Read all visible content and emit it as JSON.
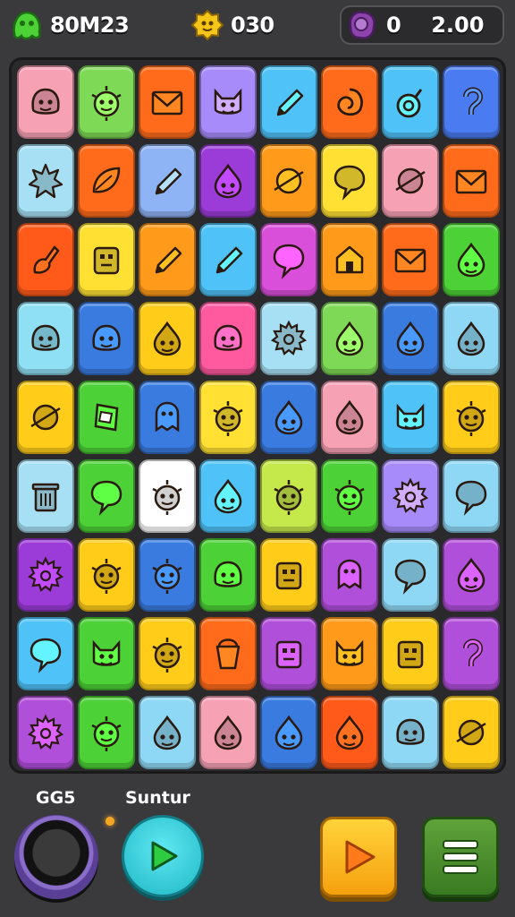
{
  "resources": {
    "gems": "80M23",
    "coins": "030",
    "energy": "0",
    "energy_max": "2.00"
  },
  "controls": {
    "left_label": "GG5",
    "right_label": "Suntur"
  },
  "colors": {
    "background": "#3a3a3d",
    "board": "#2a2a2c",
    "gem_icon": "#4cd137",
    "coin_icon": "#f5c518",
    "energy_icon": "#8e44ad"
  },
  "board": {
    "columns": 8,
    "rows": 9,
    "tiles": [
      [
        "#f7a1b5",
        "blob"
      ],
      [
        "#7ed957",
        "sun-face"
      ],
      [
        "#ff6b1a",
        "envelope"
      ],
      [
        "#a78bfa",
        "cat"
      ],
      [
        "#4fc3f7",
        "pencil"
      ],
      [
        "#ff6b1a",
        "swirl"
      ],
      [
        "#4fc3f7",
        "ring"
      ],
      [
        "#4a7bf0",
        "hook"
      ],
      [
        "#a7e0f5",
        "burst"
      ],
      [
        "#ff6b1a",
        "leaf"
      ],
      [
        "#8fb4f5",
        "pencil"
      ],
      [
        "#9b3bd8",
        "drop-face"
      ],
      [
        "#ff9a1a",
        "planet"
      ],
      [
        "#ffe033",
        "bubble"
      ],
      [
        "#f7a1b5",
        "planet"
      ],
      [
        "#ff6b1a",
        "envelope"
      ],
      [
        "#ff5a1a",
        "brush"
      ],
      [
        "#ffe033",
        "robot"
      ],
      [
        "#ff9a1a",
        "pencil"
      ],
      [
        "#4fc3f7",
        "pencil"
      ],
      [
        "#d94fd9",
        "bubble"
      ],
      [
        "#ff9a1a",
        "house"
      ],
      [
        "#ff6b1a",
        "envelope"
      ],
      [
        "#4cd137",
        "drop-face"
      ],
      [
        "#8fe0f5",
        "blob"
      ],
      [
        "#3a7be0",
        "blob"
      ],
      [
        "#ffcc1a",
        "drop-face"
      ],
      [
        "#ff5aa0",
        "blob"
      ],
      [
        "#a7e0f5",
        "gear"
      ],
      [
        "#7ed957",
        "drop-face"
      ],
      [
        "#3a7be0",
        "drop-face"
      ],
      [
        "#8fd8f5",
        "drop-face"
      ],
      [
        "#ffcc1a",
        "planet"
      ],
      [
        "#4cd137",
        "box"
      ],
      [
        "#3a7be0",
        "ghost"
      ],
      [
        "#ffe033",
        "sun-face"
      ],
      [
        "#3a7be0",
        "drop-face"
      ],
      [
        "#f7a1b5",
        "drop-face"
      ],
      [
        "#4fc3f7",
        "cat"
      ],
      [
        "#ffcc1a",
        "sun-face"
      ],
      [
        "#a7e0f5",
        "trash"
      ],
      [
        "#4cd137",
        "bubble"
      ],
      [
        "#ffffff",
        "sun-face"
      ],
      [
        "#4fc3f7",
        "drop-face"
      ],
      [
        "#c5e84a",
        "sun-face"
      ],
      [
        "#4cd137",
        "sun-face"
      ],
      [
        "#a78bfa",
        "gear"
      ],
      [
        "#8fd8f5",
        "bubble"
      ],
      [
        "#9b3bd8",
        "gear"
      ],
      [
        "#ffcc1a",
        "sun-face"
      ],
      [
        "#3a7be0",
        "sun-face"
      ],
      [
        "#4cd137",
        "blob"
      ],
      [
        "#ffcc1a",
        "robot"
      ],
      [
        "#b04fd9",
        "ghost"
      ],
      [
        "#8fd8f5",
        "bubble"
      ],
      [
        "#b04fd9",
        "drop-face"
      ],
      [
        "#4fc3f7",
        "bubble"
      ],
      [
        "#4cd137",
        "cat"
      ],
      [
        "#ffcc1a",
        "sun-face"
      ],
      [
        "#ff6b1a",
        "bucket"
      ],
      [
        "#b04fd9",
        "robot"
      ],
      [
        "#ff9a1a",
        "cat"
      ],
      [
        "#ffcc1a",
        "robot"
      ],
      [
        "#b04fd9",
        "hook"
      ],
      [
        "#b04fd9",
        "gear"
      ],
      [
        "#4cd137",
        "sun-face"
      ],
      [
        "#8fd8f5",
        "drop-face"
      ],
      [
        "#f7a1b5",
        "drop-face"
      ],
      [
        "#3a7be0",
        "drop-face"
      ],
      [
        "#ff5a1a",
        "drop-face"
      ],
      [
        "#8fd8f5",
        "blob"
      ],
      [
        "#ffcc1a",
        "planet"
      ]
    ]
  }
}
